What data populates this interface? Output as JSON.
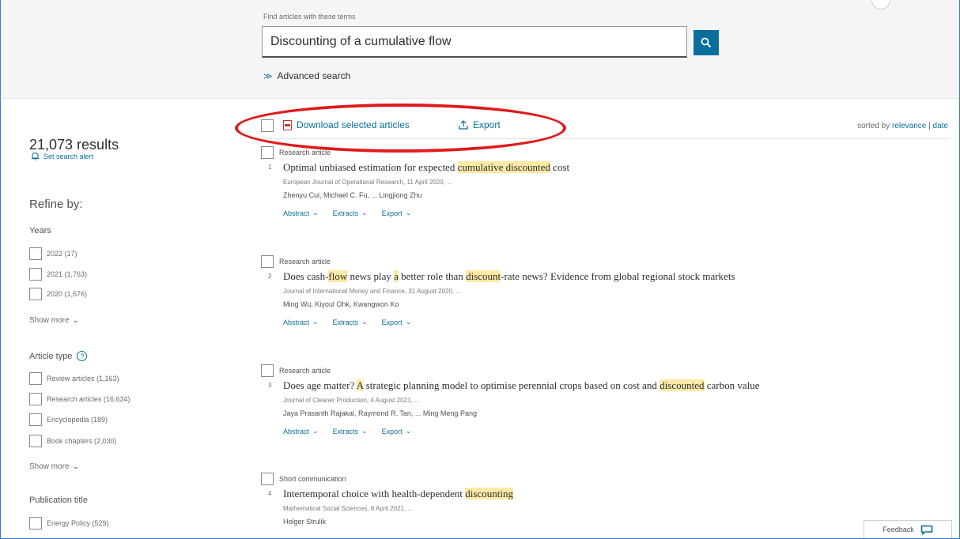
{
  "search": {
    "label": "Find articles with these terms",
    "value": "Discounting of a cumulative flow",
    "advanced_label": "Advanced search"
  },
  "sidebar": {
    "results_count": "21,073 results",
    "alert_label": "Set search alert",
    "refine_label": "Refine by:",
    "years": {
      "title": "Years",
      "items": [
        "2022 (17)",
        "2021 (1,763)",
        "2020 (1,576)"
      ],
      "show_more": "Show more"
    },
    "article_type": {
      "title": "Article type",
      "items": [
        "Review articles (1,163)",
        "Research articles (16,634)",
        "Encyclopedia (189)",
        "Book chapters (2,030)"
      ],
      "show_more": "Show more"
    },
    "publication": {
      "title": "Publication title",
      "items": [
        "Energy Policy (529)"
      ]
    }
  },
  "toolbar": {
    "download_label": "Download selected articles",
    "export_label": "Export",
    "sort_prefix": "sorted by",
    "sort_relevance": "relevance",
    "sort_separator": "|",
    "sort_date": "date"
  },
  "results": [
    {
      "type": "Research article",
      "num": "1",
      "title_parts": [
        "Optimal unbiased estimation for expected ",
        "cumulative discounted",
        " cost"
      ],
      "source": "European Journal of Operational Research, 11 April 2020, ...",
      "authors": "Zhenyu Cui, Michael C. Fu, ... Lingjiong Zhu",
      "actions": [
        "Abstract",
        "Extracts",
        "Export"
      ]
    },
    {
      "type": "Research article",
      "num": "2",
      "title_parts": [
        "Does cash-",
        "flow",
        " news play ",
        "a",
        " better role than ",
        "discount",
        "-rate news? Evidence from global regional stock markets"
      ],
      "source": "Journal of International Money and Finance, 31 August 2020, ...",
      "authors": "Ming Wu, Kiyoul Ohk, Kwangwon Ko",
      "actions": [
        "Abstract",
        "Extracts",
        "Export"
      ]
    },
    {
      "type": "Research article",
      "num": "3",
      "title_parts": [
        "Does age matter? ",
        "A",
        " strategic planning model to optimise perennial crops based on cost and ",
        "discounted",
        " carbon value"
      ],
      "source": "Journal of Cleaner Production, 4 August 2021, ...",
      "authors": "Jaya Prasanth Rajakal, Raymond R. Tan, ... Ming Meng Pang",
      "actions": [
        "Abstract",
        "Extracts",
        "Export"
      ]
    },
    {
      "type": "Short communication",
      "num": "4",
      "title_parts": [
        "Intertemporal choice with health-dependent ",
        "discounting"
      ],
      "source": "Mathematical Social Sciences, 8 April 2021, ...",
      "authors": "Holger Strulik",
      "actions": []
    }
  ],
  "feedback_label": "Feedback",
  "colors": {
    "accent": "#0a6e9c",
    "highlight": "#fde9a6",
    "annotation": "#e01a1a",
    "pdf": "#c0392b"
  }
}
